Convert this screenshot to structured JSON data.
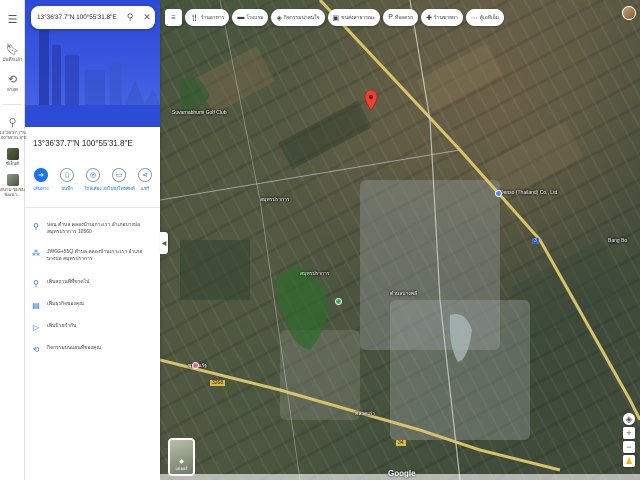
{
  "search": {
    "value": "13°36'37.7\"N 100°55'31.8\"E"
  },
  "rail": {
    "items": [
      {
        "icon": "menu-icon",
        "label": ""
      },
      {
        "icon": "bookmark-icon",
        "label": "บันทึกแล้ว"
      },
      {
        "icon": "history-icon",
        "label": "ล่าสุด"
      }
    ],
    "recent": [
      {
        "label": "13°36'37.7\"N 100°55'31.8\"E"
      },
      {
        "label": "ซีเอ็นดี"
      },
      {
        "label": "สนาม ชุมชนพัฒนา..."
      }
    ]
  },
  "place": {
    "title": "13°36'37.7\"N 100°55'31.8\"E"
  },
  "actions": [
    {
      "label": "เส้นทาง",
      "icon": "directions-icon",
      "primary": true
    },
    {
      "label": "บันทึก",
      "icon": "bookmark-icon",
      "primary": false
    },
    {
      "label": "ใกล้เคียง",
      "icon": "nearby-icon",
      "primary": false
    },
    {
      "label": "ส่งไปยังโทรศัพท์",
      "icon": "phone-icon",
      "primary": false
    },
    {
      "label": "แชร์",
      "icon": "share-icon",
      "primary": false
    }
  ],
  "info": [
    {
      "icon": "location-pin-icon",
      "text": "บอนุ ตำบล คลองบ้านเกาะเรา อำเภอบางบ่อ สมุทรปราการ 10560"
    },
    {
      "icon": "plus-code-icon",
      "text": "JW6G+55Q ตำบล คลองบ้านเกาะเรา อำเภอบางบ่อ สมุทรปราการ"
    },
    {
      "icon": "add-place-icon",
      "text": "เพิ่มสถานที่ที่ขาดไป"
    },
    {
      "icon": "business-icon",
      "text": "เพิ่มธุรกิจของคุณ"
    },
    {
      "icon": "label-icon",
      "text": "เพิ่มป้ายกำกับ"
    },
    {
      "icon": "history-icon",
      "text": "กิจกรรมบนแผนที่ของคุณ"
    }
  ],
  "chips": [
    {
      "icon": "restaurant-icon",
      "label": "ร้านอาหาร"
    },
    {
      "icon": "hotel-icon",
      "label": "โรงแรม"
    },
    {
      "icon": "attraction-icon",
      "label": "กิจกรรมน่าสนใจ"
    },
    {
      "icon": "transit-icon",
      "label": "ขนส่งสาธารณะ"
    },
    {
      "icon": "parking-icon",
      "label": "ที่จอดรถ"
    },
    {
      "icon": "pharmacy-icon",
      "label": "ร้านขายยา"
    },
    {
      "icon": "more-icon",
      "label": "ตู้เอทีเอ็ม"
    }
  ],
  "map_labels": [
    {
      "text": "Suvarnabhumi Golf Club"
    },
    {
      "text": "Denso (Thailand) Co., Ltd."
    },
    {
      "text": "สมุทรปราการ"
    },
    {
      "text": "สมุทรปราการ"
    },
    {
      "text": "Bang Bo"
    },
    {
      "text": "ชุมชนรัฐ"
    },
    {
      "text": "ตลาดเก่า"
    },
    {
      "text": "ตำบลบางพลี"
    }
  ],
  "road_labels": [
    {
      "text": "3"
    },
    {
      "text": "34"
    },
    {
      "text": "3268"
    }
  ],
  "layers": {
    "label": "เลเยอร์"
  },
  "logo": "Google",
  "colors": {
    "accent": "#1a73e8",
    "pin": "#ea4335",
    "hero": "#3a59e0",
    "road": "#d9c36a"
  }
}
